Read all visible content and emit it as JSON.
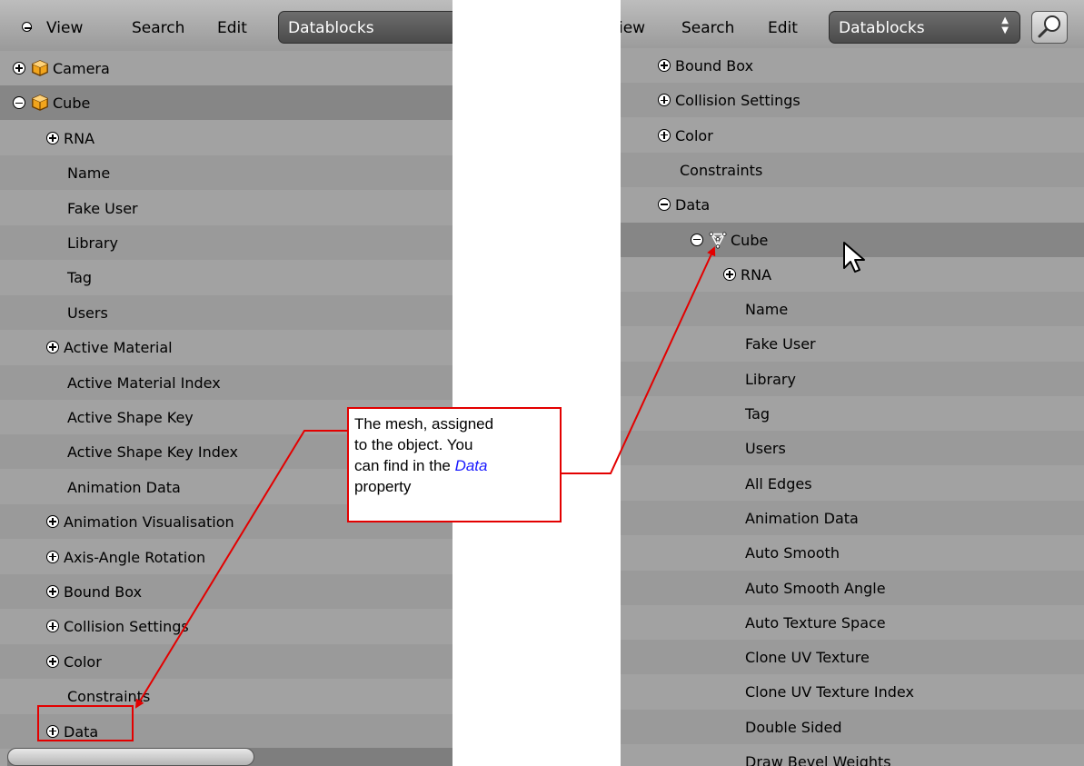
{
  "left": {
    "header": {
      "collapse_icon": "minus-circle-icon",
      "menu": [
        "View",
        "Search",
        "Edit"
      ],
      "datablocks": "Datablocks"
    },
    "rows": [
      {
        "label": "Camera",
        "expander": "plus",
        "icon": "object-icon"
      },
      {
        "label": "Cube",
        "expander": "minus",
        "icon": "object-icon",
        "selected": true
      },
      {
        "label": "RNA",
        "expander": "plus"
      },
      {
        "label": "Name"
      },
      {
        "label": "Fake User"
      },
      {
        "label": "Library"
      },
      {
        "label": "Tag"
      },
      {
        "label": "Users"
      },
      {
        "label": "Active Material",
        "expander": "plus"
      },
      {
        "label": "Active Material Index"
      },
      {
        "label": "Active Shape Key"
      },
      {
        "label": "Active Shape Key Index"
      },
      {
        "label": "Animation Data"
      },
      {
        "label": "Animation Visualisation",
        "expander": "plus"
      },
      {
        "label": "Axis-Angle Rotation",
        "expander": "plus"
      },
      {
        "label": "Bound Box",
        "expander": "plus"
      },
      {
        "label": "Collision Settings",
        "expander": "plus"
      },
      {
        "label": "Color",
        "expander": "plus"
      },
      {
        "label": "Constraints"
      },
      {
        "label": "Data",
        "expander": "plus"
      }
    ]
  },
  "right": {
    "header": {
      "menu": [
        "iew",
        "Search",
        "Edit"
      ],
      "datablocks": "Datablocks",
      "search_icon": "magnifier-icon"
    },
    "rows": [
      {
        "label": "Bound Box",
        "expander": "plus"
      },
      {
        "label": "Collision Settings",
        "expander": "plus"
      },
      {
        "label": "Color",
        "expander": "plus"
      },
      {
        "label": "Constraints"
      },
      {
        "label": "Data",
        "expander": "minus"
      },
      {
        "label": "Cube",
        "expander": "minus",
        "icon": "mesh-icon",
        "selected": true
      },
      {
        "label": "RNA",
        "expander": "plus"
      },
      {
        "label": "Name"
      },
      {
        "label": "Fake User"
      },
      {
        "label": "Library"
      },
      {
        "label": "Tag"
      },
      {
        "label": "Users"
      },
      {
        "label": "All Edges"
      },
      {
        "label": "Animation Data"
      },
      {
        "label": "Auto Smooth"
      },
      {
        "label": "Auto Smooth Angle"
      },
      {
        "label": "Auto Texture Space"
      },
      {
        "label": "Clone UV Texture"
      },
      {
        "label": "Clone UV Texture Index"
      },
      {
        "label": "Double Sided"
      },
      {
        "label": "Draw Bevel Weights"
      }
    ]
  },
  "callout": {
    "line1": "The mesh, assigned",
    "line2": "to the object. You",
    "line3_pre": "can find in the ",
    "line3_hl": "Data",
    "line4": "property"
  },
  "colors": {
    "annotation": "#e30000",
    "highlight_word": "#1a1aff",
    "panel": "#a2a2a2",
    "row_alt": "#9a9a9a",
    "row_selected": "#868686"
  }
}
